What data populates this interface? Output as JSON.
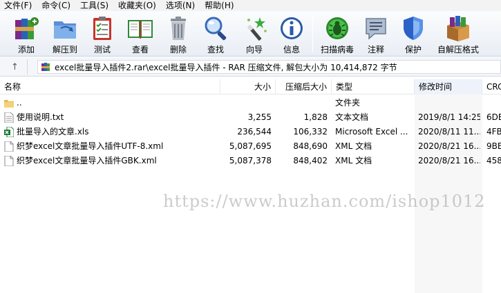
{
  "menu": [
    {
      "label": "文件(F)"
    },
    {
      "label": "命令(C)"
    },
    {
      "label": "工具(S)"
    },
    {
      "label": "收藏夹(O)"
    },
    {
      "label": "选项(N)"
    },
    {
      "label": "帮助(H)"
    }
  ],
  "toolbar": {
    "buttons": [
      {
        "label": "添加",
        "icon": "books-add-icon"
      },
      {
        "label": "解压到",
        "icon": "folder-extract-icon"
      },
      {
        "label": "测试",
        "icon": "clipboard-test-icon"
      },
      {
        "label": "查看",
        "icon": "open-book-icon"
      },
      {
        "label": "删除",
        "icon": "trash-can-icon"
      },
      {
        "label": "查找",
        "icon": "magnifier-icon"
      },
      {
        "label": "向导",
        "icon": "magic-wand-icon"
      },
      {
        "label": "信息",
        "icon": "info-icon"
      },
      {
        "label": "扫描病毒",
        "icon": "virus-scan-icon"
      },
      {
        "label": "注释",
        "icon": "comment-icon"
      },
      {
        "label": "保护",
        "icon": "shield-icon"
      },
      {
        "label": "自解压格式",
        "icon": "sfx-box-icon"
      }
    ]
  },
  "pathbar": {
    "path": "excel批量导入插件2.rar\\excel批量导入插件 - RAR 压缩文件, 解包大小为 10,414,872 字节"
  },
  "columns": [
    "名称",
    "大小",
    "压缩后大小",
    "类型",
    "修改时间",
    "CRC"
  ],
  "files": [
    {
      "name": "..",
      "size": "",
      "packed": "",
      "type": "文件夹",
      "modified": "",
      "crc": "",
      "icon": "folder-icon"
    },
    {
      "name": "使用说明.txt",
      "size": "3,255",
      "packed": "1,828",
      "type": "文本文档",
      "modified": "2019/8/1 14:25",
      "crc": "6DE",
      "icon": "text-file-icon"
    },
    {
      "name": "批量导入的文章.xls",
      "size": "236,544",
      "packed": "106,332",
      "type": "Microsoft Excel ...",
      "modified": "2020/8/11 11...",
      "crc": "4FB",
      "icon": "excel-file-icon"
    },
    {
      "name": "织梦excel文章批量导入插件UTF-8.xml",
      "size": "5,087,695",
      "packed": "848,690",
      "type": "XML 文档",
      "modified": "2020/8/21 16...",
      "crc": "9BE",
      "icon": "xml-file-icon"
    },
    {
      "name": "织梦excel文章批量导入插件GBK.xml",
      "size": "5,087,378",
      "packed": "848,402",
      "type": "XML 文档",
      "modified": "2020/8/21 16...",
      "crc": "458",
      "icon": "xml-file-icon"
    }
  ],
  "watermark": "https://www.huzhan.com/ishop1012"
}
